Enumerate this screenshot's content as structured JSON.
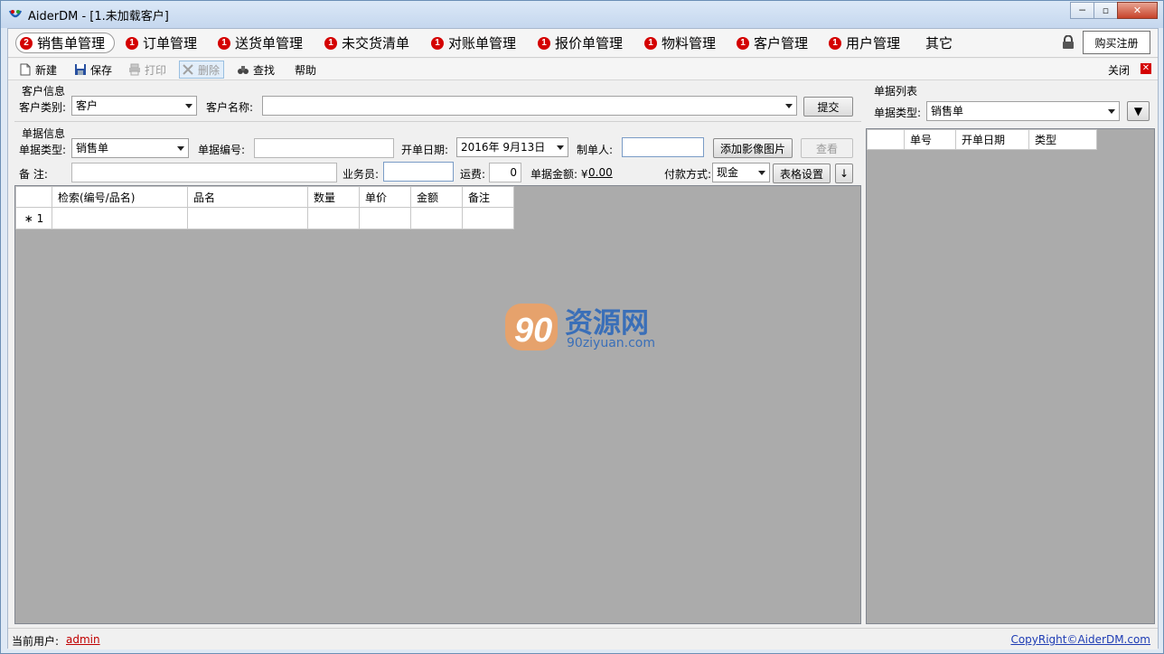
{
  "window": {
    "title": "AiderDM - [1.未加载客户]",
    "minimize_label": "─",
    "restore_label": "▫",
    "close_label": "✕"
  },
  "tabs": [
    {
      "badge": "2",
      "label": "销售单管理",
      "active": true
    },
    {
      "badge": "1",
      "label": "订单管理"
    },
    {
      "badge": "1",
      "label": "送货单管理"
    },
    {
      "badge": "1",
      "label": "未交货清单"
    },
    {
      "badge": "1",
      "label": "对账单管理"
    },
    {
      "badge": "1",
      "label": "报价单管理"
    },
    {
      "badge": "1",
      "label": "物料管理"
    },
    {
      "badge": "1",
      "label": "客户管理"
    },
    {
      "badge": "1",
      "label": "用户管理"
    },
    {
      "label": "其它"
    }
  ],
  "buy_label": "购买注册",
  "toolbar": {
    "new_label": "新建",
    "save_label": "保存",
    "print_label": "打印",
    "delete_label": "删除",
    "find_label": "查找",
    "help_label": "帮助",
    "close_label": "关闭",
    "close_x": "✕"
  },
  "customer": {
    "section_title": "客户信息",
    "type_label": "客户类别:",
    "type_value": "客户",
    "name_label": "客户名称:",
    "name_value": "",
    "submit_label": "提交"
  },
  "document": {
    "section_title": "单据信息",
    "type_label": "单据类型:",
    "type_value": "销售单",
    "number_label": "单据编号:",
    "number_value": "",
    "date_label": "开单日期:",
    "date_value": "2016年  9月13日",
    "maker_label": "制单人:",
    "maker_value": "",
    "add_image_label": "添加影像图片",
    "view_label": "查看",
    "remark_label": "备    注:",
    "remark_value": "",
    "sales_label": "业务员:",
    "sales_value": "",
    "freight_label": "运费:",
    "freight_value": "0",
    "amount_label": "单据金额: ¥",
    "amount_value": "0.00",
    "payment_label": "付款方式:",
    "payment_value": "现金",
    "table_settings_label": "表格设置",
    "down_label": "↓"
  },
  "grid": {
    "columns": [
      "",
      "检索(编号/品名)",
      "品名",
      "数量",
      "单价",
      "金额",
      "备注"
    ],
    "rows": [
      {
        "marker": "∗",
        "index": "1"
      }
    ]
  },
  "watermark": {
    "brand": "资源网",
    "url": "90ziyuan.com"
  },
  "right_panel": {
    "section_title": "单据列表",
    "type_label": "单据类型:",
    "type_value": "销售单",
    "dropdown_btn": "▼",
    "columns": [
      "",
      "单号",
      "开单日期",
      "类型"
    ]
  },
  "status": {
    "user_label": "当前用户:",
    "user_value": "admin",
    "copyright": "CopyRight©AiderDM.com"
  },
  "colors": {
    "badge": "#d40000",
    "accent": "#1e3cb4",
    "grid_bg": "#ababab"
  }
}
